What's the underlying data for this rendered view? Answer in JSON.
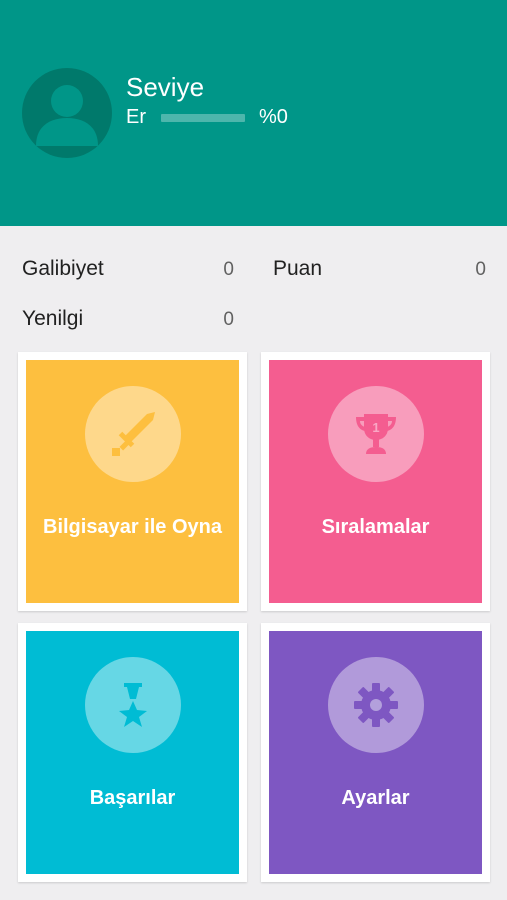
{
  "profile": {
    "level_title": "Seviye",
    "rank": "Er",
    "progress_percent_text": "%0",
    "progress_fraction": 0
  },
  "stats": {
    "wins_label": "Galibiyet",
    "wins_value": "0",
    "points_label": "Puan",
    "points_value": "0",
    "losses_label": "Yenilgi",
    "losses_value": "0"
  },
  "menu": {
    "play_computer": {
      "label": "Bilgisayar ile Oyna",
      "color": "#fdbf3f",
      "icon": "sword-icon"
    },
    "leaderboards": {
      "label": "Sıralamalar",
      "color": "#f45d90",
      "icon": "trophy-icon",
      "trophy_number": "1"
    },
    "achievements": {
      "label": "Başarılar",
      "color": "#00bcd4",
      "icon": "medal-icon"
    },
    "settings": {
      "label": "Ayarlar",
      "color": "#7e57c2",
      "icon": "gear-icon"
    }
  },
  "colors": {
    "header": "#009688",
    "avatar_bg": "#00796b",
    "background": "#efeef0"
  }
}
